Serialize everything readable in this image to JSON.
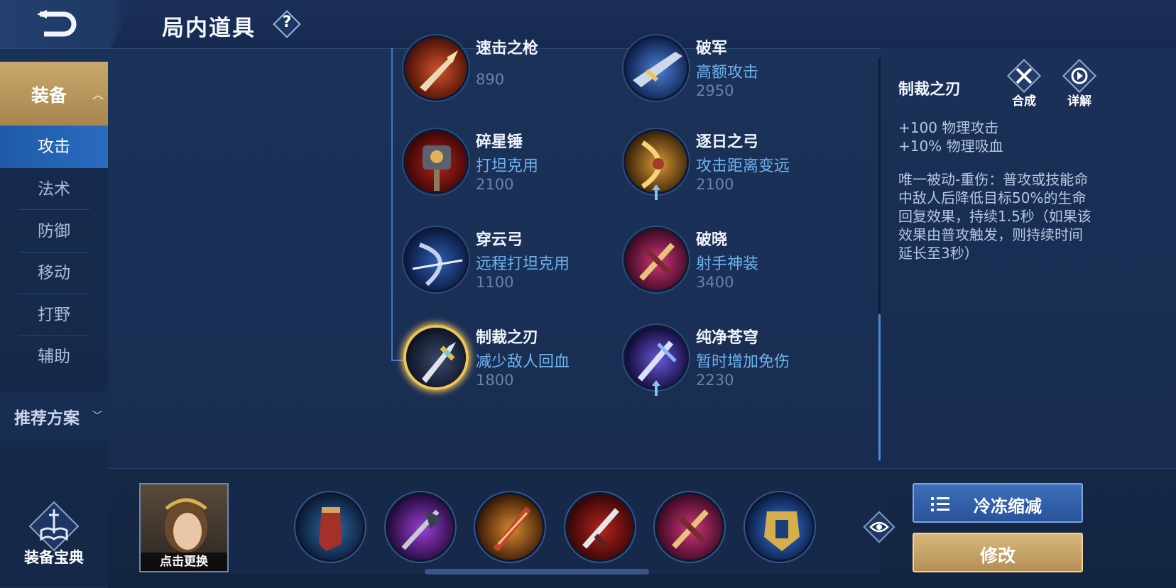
{
  "header": {
    "title": "局内道具",
    "help_label": "?"
  },
  "sidebar": {
    "category": "装备",
    "items": [
      "攻击",
      "法术",
      "防御",
      "移动",
      "打野",
      "辅助"
    ],
    "active_index": 0,
    "recommend_label": "推荐方案",
    "codex_label": "装备宝典"
  },
  "items": [
    {
      "name": "速击之枪",
      "tag": "",
      "price": "890",
      "icon": "spear-icon"
    },
    {
      "name": "破军",
      "tag": "高额攻击",
      "price": "2950",
      "icon": "greatsword-icon"
    },
    {
      "name": "碎星锤",
      "tag": "打坦克用",
      "price": "2100",
      "icon": "hammer-icon"
    },
    {
      "name": "逐日之弓",
      "tag": "攻击距离变远",
      "price": "2100",
      "icon": "sun-bow-icon"
    },
    {
      "name": "穿云弓",
      "tag": "远程打坦克用",
      "price": "1100",
      "icon": "cloud-bow-icon"
    },
    {
      "name": "破晓",
      "tag": "射手神装",
      "price": "3400",
      "icon": "dawn-crossbow-icon"
    },
    {
      "name": "制裁之刃",
      "tag": "减少敌人回血",
      "price": "1800",
      "icon": "judgement-blade-icon"
    },
    {
      "name": "纯净苍穹",
      "tag": "暂时增加免伤",
      "price": "2230",
      "icon": "pure-sky-icon"
    }
  ],
  "detail": {
    "name": "制裁之刃",
    "stats": [
      "+100 物理攻击",
      "+10% 物理吸血"
    ],
    "description": "唯一被动-重伤：普攻或技能命中敌人后降低目标50%的生命回复效果，持续1.5秒（如果该效果由普攻触发，则持续时间延长至3秒）",
    "compose_label": "合成",
    "details_label": "详解"
  },
  "bottom": {
    "hero_caption": "点击更换",
    "slots": [
      "boots-icon",
      "dark-axe-icon",
      "flame-blade-icon",
      "blood-blade-icon",
      "dawn-crossbow-icon",
      "golden-armor-icon"
    ],
    "cooldown_label": "冷冻缩减",
    "modify_label": "修改"
  },
  "colors": {
    "accent_blue": "#3f78c7",
    "gold": "#caa86a",
    "tag_blue": "#6fb3ee",
    "price_gray": "#6d81a4"
  }
}
